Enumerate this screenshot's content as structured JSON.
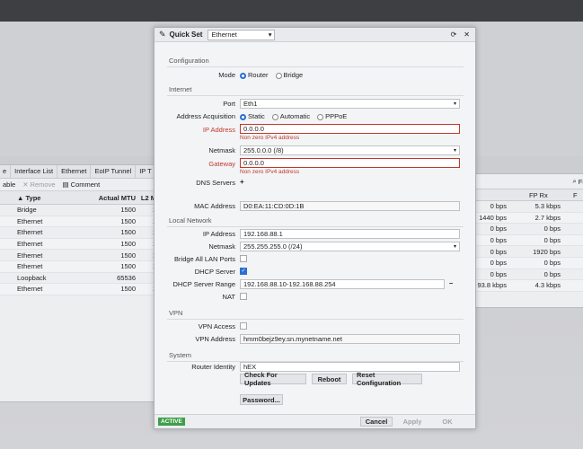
{
  "bg_left": {
    "tabs": [
      "e",
      "Interface List",
      "Ethernet",
      "EoIP Tunnel",
      "IP T"
    ],
    "toolbar": [
      "able",
      "Remove",
      "Comment"
    ],
    "columns": [
      "Type",
      "Actual MTU",
      "L2 M"
    ],
    "rows": [
      {
        "type": "Bridge",
        "mtu": "1500",
        "l2": "1"
      },
      {
        "type": "Ethernet",
        "mtu": "1500",
        "l2": "1"
      },
      {
        "type": "Ethernet",
        "mtu": "1500",
        "l2": "1"
      },
      {
        "type": "Ethernet",
        "mtu": "1500",
        "l2": "1"
      },
      {
        "type": "Ethernet",
        "mtu": "1500",
        "l2": "1"
      },
      {
        "type": "Ethernet",
        "mtu": "1500",
        "l2": "1"
      },
      {
        "type": "Loopback",
        "mtu": "65536",
        "l2": ""
      },
      {
        "type": "Ethernet",
        "mtu": "1500",
        "l2": "1"
      }
    ]
  },
  "bg_right": {
    "find_stub": "Fi",
    "columns": [
      "",
      "FP Rx",
      "F"
    ],
    "rows": [
      {
        "a": "0 bps",
        "b": "5.3 kbps"
      },
      {
        "a": "1440 bps",
        "b": "2.7 kbps"
      },
      {
        "a": "0 bps",
        "b": "0 bps"
      },
      {
        "a": "0 bps",
        "b": "0 bps"
      },
      {
        "a": "0 bps",
        "b": "1920 bps"
      },
      {
        "a": "0 bps",
        "b": "0 bps"
      },
      {
        "a": "0 bps",
        "b": "0 bps"
      },
      {
        "a": "93.8 kbps",
        "b": "4.3 kbps"
      }
    ]
  },
  "dialog": {
    "title": "Quick Set",
    "mode_select": "Ethernet",
    "sections": {
      "configuration": "Configuration",
      "internet": "Internet",
      "local_network": "Local Network",
      "vpn": "VPN",
      "system": "System"
    },
    "labels": {
      "mode": "Mode",
      "port": "Port",
      "address_acquisition": "Address Acquisition",
      "ip_address": "IP Address",
      "netmask": "Netmask",
      "gateway": "Gateway",
      "dns_servers": "DNS Servers",
      "mac_address": "MAC Address",
      "lan_ip_address": "IP Address",
      "lan_netmask": "Netmask",
      "bridge_all_lan": "Bridge All LAN Ports",
      "dhcp_server": "DHCP Server",
      "dhcp_range": "DHCP Server Range",
      "nat": "NAT",
      "vpn_access": "VPN Access",
      "vpn_address": "VPN Address",
      "router_identity": "Router Identity"
    },
    "mode_options": [
      "Router",
      "Bridge"
    ],
    "acq_options": [
      "Static",
      "Automatic",
      "PPPoE"
    ],
    "values": {
      "port": "Eth1",
      "ip_address": "0.0.0.0",
      "ip_error": "Non zero IPv4 address",
      "netmask": "255.0.0.0 (/8)",
      "gateway": "0.0.0.0",
      "gateway_error": "Non zero IPv4 address",
      "dns_add": "+",
      "mac_address": "D0:EA:11:CD:0D:1B",
      "lan_ip": "192.168.88.1",
      "lan_netmask": "255.255.255.0 (/24)",
      "dhcp_range": "192.168.88.10-192.168.88.254",
      "dhcp_range_remove": "−",
      "vpn_address": "hmm0bejz9ey.sn.mynetname.net",
      "router_identity": "hEX"
    },
    "buttons": {
      "check_updates": "Check For Updates",
      "reboot": "Reboot",
      "reset_config": "Reset Configuration",
      "password": "Password..."
    },
    "footer": {
      "status": "ACTIVE",
      "cancel": "Cancel",
      "apply": "Apply",
      "ok": "OK"
    },
    "colors": {
      "error": "#c0392b",
      "accent": "#2a6fd1",
      "active": "#3f9e4a"
    }
  }
}
